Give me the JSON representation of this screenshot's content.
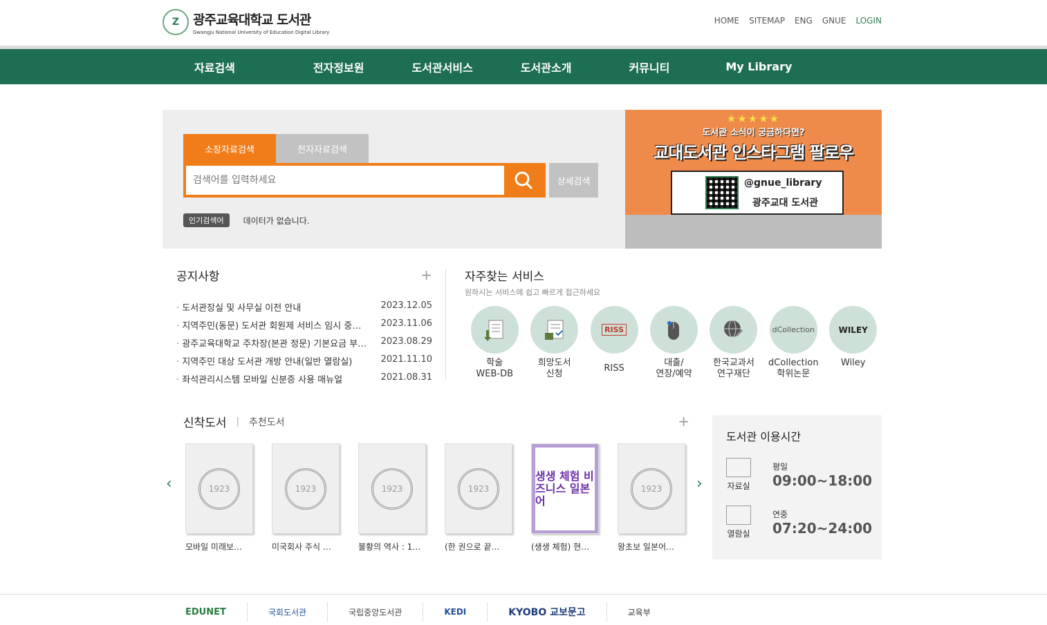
{
  "header": {
    "logo_kr": "광주교육대학교 도서관",
    "logo_en": "Gwangju National University of Education  Digital Library",
    "util": [
      "HOME",
      "SITEMAP",
      "ENG",
      "GNUE",
      "LOGIN"
    ]
  },
  "nav": [
    "자료검색",
    "전자정보원",
    "도서관서비스",
    "도서관소개",
    "커뮤니티",
    "My Library"
  ],
  "search": {
    "tab_active": "소장자료검색",
    "tab_inactive": "전자자료검색",
    "placeholder": "검색어를 입력하세요",
    "advanced": "상세검색",
    "popular_label": "인기검색어",
    "popular_value": "데이터가 없습니다."
  },
  "banner": {
    "stars": "★★★★★",
    "sub": "도서관 소식이 궁금하다면?",
    "main": "교대도서관 인스타그램 팔로우",
    "handle": "@gnue_library",
    "lib": "광주교대 도서관"
  },
  "notice": {
    "title": "공지사항",
    "items": [
      {
        "title": "도서관장실 및 사무실 이전 안내",
        "date": "2023.12.05"
      },
      {
        "title": "지역주민(동문) 도서관 회원제 서비스 임시 중…",
        "date": "2023.11.06"
      },
      {
        "title": "광주교육대학교 주차장(본관 정문) 기본요금 부…",
        "date": "2023.08.29"
      },
      {
        "title": "지역주민 대상 도서관 개방 안내(일반 열람실)",
        "date": "2021.11.10"
      },
      {
        "title": "좌석관리시스템 모바일 신분증 사용 매뉴얼",
        "date": "2021.08.31"
      }
    ]
  },
  "services": {
    "title": "자주찾는 서비스",
    "desc": "원하시는 서비스에 쉽고 빠르게 접근하세요",
    "items": [
      {
        "label": "학술\nWEB-DB",
        "icon": "document-download-icon",
        "mark": ""
      },
      {
        "label": "희망도서\n신청",
        "icon": "request-form-icon",
        "mark": ""
      },
      {
        "label": "RISS",
        "icon": "riss-logo-icon",
        "mark": "RISS"
      },
      {
        "label": "대출/\n연장/예약",
        "icon": "mouse-icon",
        "mark": ""
      },
      {
        "label": "한국교과서\n연구재단",
        "icon": "globe-icon",
        "mark": ""
      },
      {
        "label": "dCollection\n학위논문",
        "icon": "dcollection-logo-icon",
        "mark": "dCollection"
      },
      {
        "label": "Wiley",
        "icon": "wiley-logo-icon",
        "mark": "WILEY"
      }
    ]
  },
  "books": {
    "tab_active": "신착도서",
    "tab_inactive": "추천도서",
    "items": [
      {
        "title": "모바일 미래보…"
      },
      {
        "title": "미국회사 주식 …"
      },
      {
        "title": "불황의 역사 : 1…"
      },
      {
        "title": "(한 권으로 끝…"
      },
      {
        "title": "(생생 체험) 현…",
        "cover_text": "생생 체험 비즈니스 일본어"
      },
      {
        "title": "왕초보 일본어…"
      }
    ]
  },
  "hours": {
    "title": "도서관 이용시간",
    "rows": [
      {
        "place": "자료실",
        "day": "평일",
        "time": "09:00~18:00"
      },
      {
        "place": "열람실",
        "day": "연중",
        "time": "07:20~24:00"
      }
    ]
  },
  "footer": [
    "EDUNET",
    "국회도서관",
    "국립중앙도서관",
    "KEDI",
    "KYOBO 교보문고",
    "교육부"
  ]
}
